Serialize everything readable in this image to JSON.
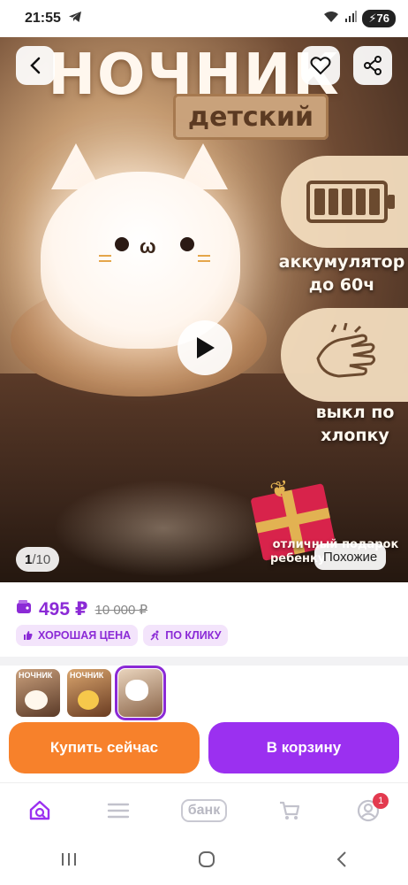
{
  "status_bar": {
    "time": "21:55",
    "battery": "76"
  },
  "hero": {
    "title": "НОЧНИК",
    "subtitle": "детский",
    "feature_battery": [
      "аккумулятор",
      "до 60ч"
    ],
    "feature_clap": [
      "выкл по",
      "хлопку"
    ],
    "feature_gift": [
      "отличный подарок",
      "ребенку"
    ],
    "counter_current": "1",
    "counter_total": "/10",
    "similar_label": "Похожие"
  },
  "price": {
    "current": "495 ₽",
    "old": "10 000 ₽"
  },
  "tags": [
    {
      "label": "ХОРОШАЯ ЦЕНА",
      "icon": "thumbs-up-icon"
    },
    {
      "label": "ПО КЛИКУ",
      "icon": "running-icon"
    }
  ],
  "thumbnails": [
    {
      "caption": "НОЧНИК"
    },
    {
      "caption": "НОЧНИК"
    },
    {
      "caption": ""
    }
  ],
  "actions": {
    "buy_now": "Купить сейчас",
    "add_to_cart": "В корзину"
  },
  "bottom_nav": {
    "bank_label": "банк",
    "profile_badge": "1"
  },
  "colors": {
    "accent": "#9b30f0",
    "buy": "#f7812b",
    "price": "#8b2ad6"
  }
}
